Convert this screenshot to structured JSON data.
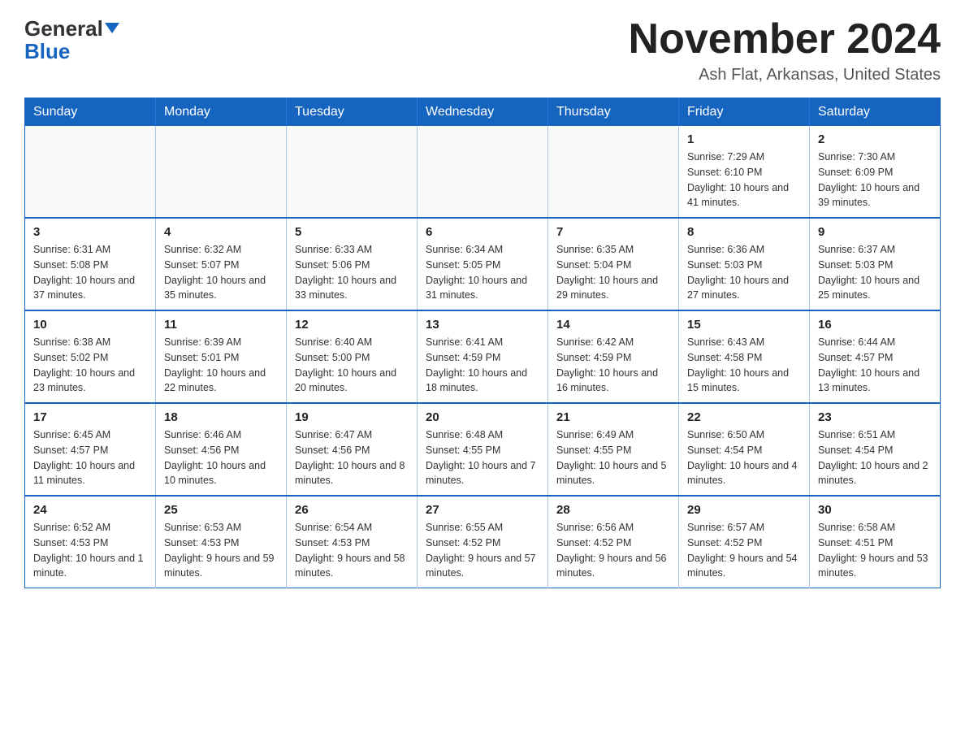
{
  "header": {
    "logo_general": "General",
    "logo_blue": "Blue",
    "month_title": "November 2024",
    "subtitle": "Ash Flat, Arkansas, United States"
  },
  "weekdays": [
    "Sunday",
    "Monday",
    "Tuesday",
    "Wednesday",
    "Thursday",
    "Friday",
    "Saturday"
  ],
  "weeks": [
    [
      {
        "day": "",
        "info": ""
      },
      {
        "day": "",
        "info": ""
      },
      {
        "day": "",
        "info": ""
      },
      {
        "day": "",
        "info": ""
      },
      {
        "day": "",
        "info": ""
      },
      {
        "day": "1",
        "info": "Sunrise: 7:29 AM\nSunset: 6:10 PM\nDaylight: 10 hours and 41 minutes."
      },
      {
        "day": "2",
        "info": "Sunrise: 7:30 AM\nSunset: 6:09 PM\nDaylight: 10 hours and 39 minutes."
      }
    ],
    [
      {
        "day": "3",
        "info": "Sunrise: 6:31 AM\nSunset: 5:08 PM\nDaylight: 10 hours and 37 minutes."
      },
      {
        "day": "4",
        "info": "Sunrise: 6:32 AM\nSunset: 5:07 PM\nDaylight: 10 hours and 35 minutes."
      },
      {
        "day": "5",
        "info": "Sunrise: 6:33 AM\nSunset: 5:06 PM\nDaylight: 10 hours and 33 minutes."
      },
      {
        "day": "6",
        "info": "Sunrise: 6:34 AM\nSunset: 5:05 PM\nDaylight: 10 hours and 31 minutes."
      },
      {
        "day": "7",
        "info": "Sunrise: 6:35 AM\nSunset: 5:04 PM\nDaylight: 10 hours and 29 minutes."
      },
      {
        "day": "8",
        "info": "Sunrise: 6:36 AM\nSunset: 5:03 PM\nDaylight: 10 hours and 27 minutes."
      },
      {
        "day": "9",
        "info": "Sunrise: 6:37 AM\nSunset: 5:03 PM\nDaylight: 10 hours and 25 minutes."
      }
    ],
    [
      {
        "day": "10",
        "info": "Sunrise: 6:38 AM\nSunset: 5:02 PM\nDaylight: 10 hours and 23 minutes."
      },
      {
        "day": "11",
        "info": "Sunrise: 6:39 AM\nSunset: 5:01 PM\nDaylight: 10 hours and 22 minutes."
      },
      {
        "day": "12",
        "info": "Sunrise: 6:40 AM\nSunset: 5:00 PM\nDaylight: 10 hours and 20 minutes."
      },
      {
        "day": "13",
        "info": "Sunrise: 6:41 AM\nSunset: 4:59 PM\nDaylight: 10 hours and 18 minutes."
      },
      {
        "day": "14",
        "info": "Sunrise: 6:42 AM\nSunset: 4:59 PM\nDaylight: 10 hours and 16 minutes."
      },
      {
        "day": "15",
        "info": "Sunrise: 6:43 AM\nSunset: 4:58 PM\nDaylight: 10 hours and 15 minutes."
      },
      {
        "day": "16",
        "info": "Sunrise: 6:44 AM\nSunset: 4:57 PM\nDaylight: 10 hours and 13 minutes."
      }
    ],
    [
      {
        "day": "17",
        "info": "Sunrise: 6:45 AM\nSunset: 4:57 PM\nDaylight: 10 hours and 11 minutes."
      },
      {
        "day": "18",
        "info": "Sunrise: 6:46 AM\nSunset: 4:56 PM\nDaylight: 10 hours and 10 minutes."
      },
      {
        "day": "19",
        "info": "Sunrise: 6:47 AM\nSunset: 4:56 PM\nDaylight: 10 hours and 8 minutes."
      },
      {
        "day": "20",
        "info": "Sunrise: 6:48 AM\nSunset: 4:55 PM\nDaylight: 10 hours and 7 minutes."
      },
      {
        "day": "21",
        "info": "Sunrise: 6:49 AM\nSunset: 4:55 PM\nDaylight: 10 hours and 5 minutes."
      },
      {
        "day": "22",
        "info": "Sunrise: 6:50 AM\nSunset: 4:54 PM\nDaylight: 10 hours and 4 minutes."
      },
      {
        "day": "23",
        "info": "Sunrise: 6:51 AM\nSunset: 4:54 PM\nDaylight: 10 hours and 2 minutes."
      }
    ],
    [
      {
        "day": "24",
        "info": "Sunrise: 6:52 AM\nSunset: 4:53 PM\nDaylight: 10 hours and 1 minute."
      },
      {
        "day": "25",
        "info": "Sunrise: 6:53 AM\nSunset: 4:53 PM\nDaylight: 9 hours and 59 minutes."
      },
      {
        "day": "26",
        "info": "Sunrise: 6:54 AM\nSunset: 4:53 PM\nDaylight: 9 hours and 58 minutes."
      },
      {
        "day": "27",
        "info": "Sunrise: 6:55 AM\nSunset: 4:52 PM\nDaylight: 9 hours and 57 minutes."
      },
      {
        "day": "28",
        "info": "Sunrise: 6:56 AM\nSunset: 4:52 PM\nDaylight: 9 hours and 56 minutes."
      },
      {
        "day": "29",
        "info": "Sunrise: 6:57 AM\nSunset: 4:52 PM\nDaylight: 9 hours and 54 minutes."
      },
      {
        "day": "30",
        "info": "Sunrise: 6:58 AM\nSunset: 4:51 PM\nDaylight: 9 hours and 53 minutes."
      }
    ]
  ]
}
